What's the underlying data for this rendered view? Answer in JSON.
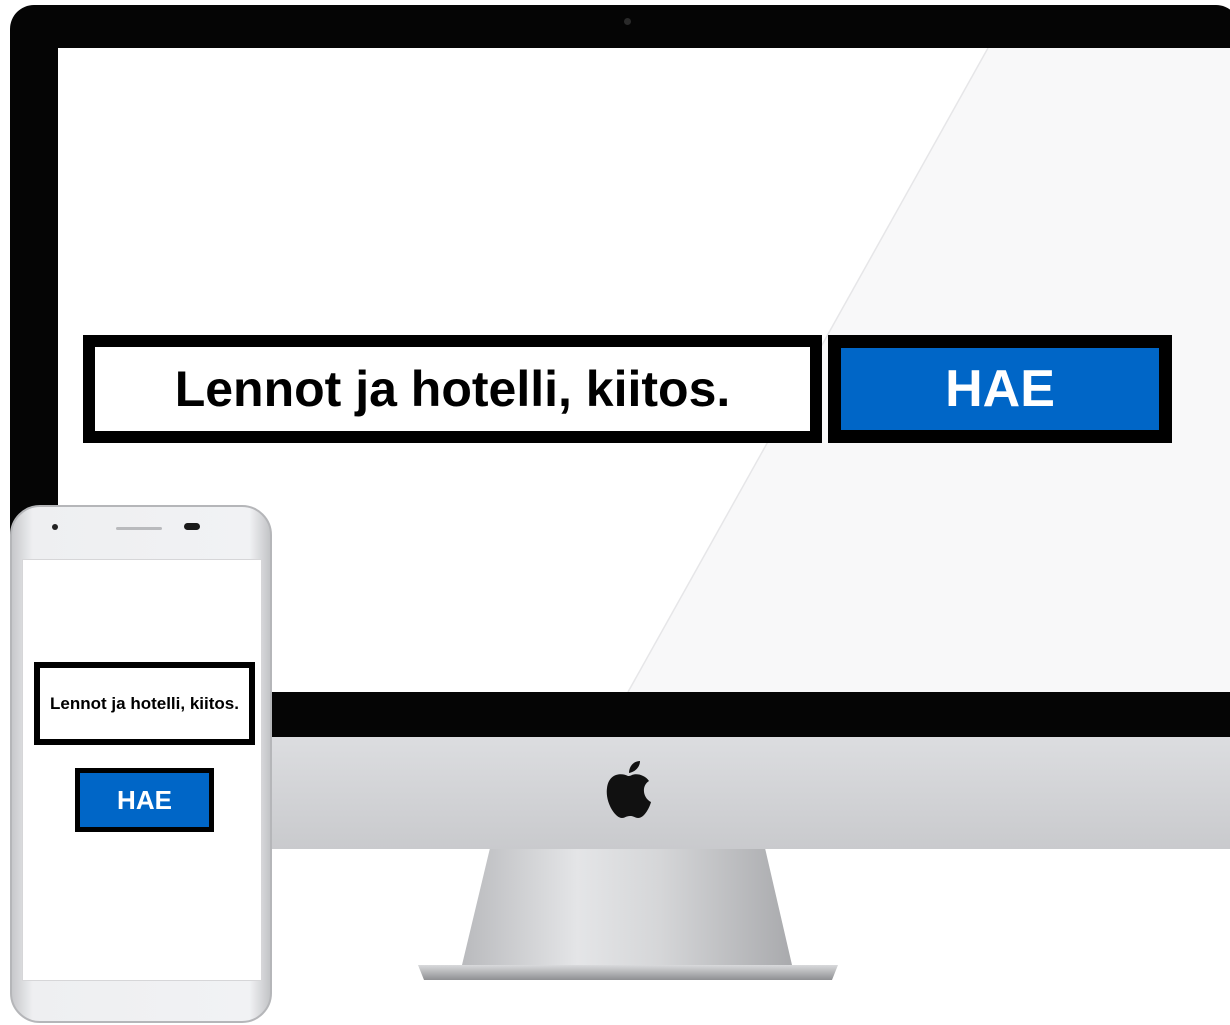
{
  "desktop": {
    "search_text": "Lennot ja hotelli, kiitos.",
    "search_button_label": "HAE",
    "logo_icon": "apple-icon"
  },
  "mobile": {
    "search_text": "Lennot ja hotelli, kiitos.",
    "search_button_label": "HAE"
  },
  "colors": {
    "button_blue": "#0066c7",
    "border": "#000000",
    "bezel": "#050505"
  }
}
